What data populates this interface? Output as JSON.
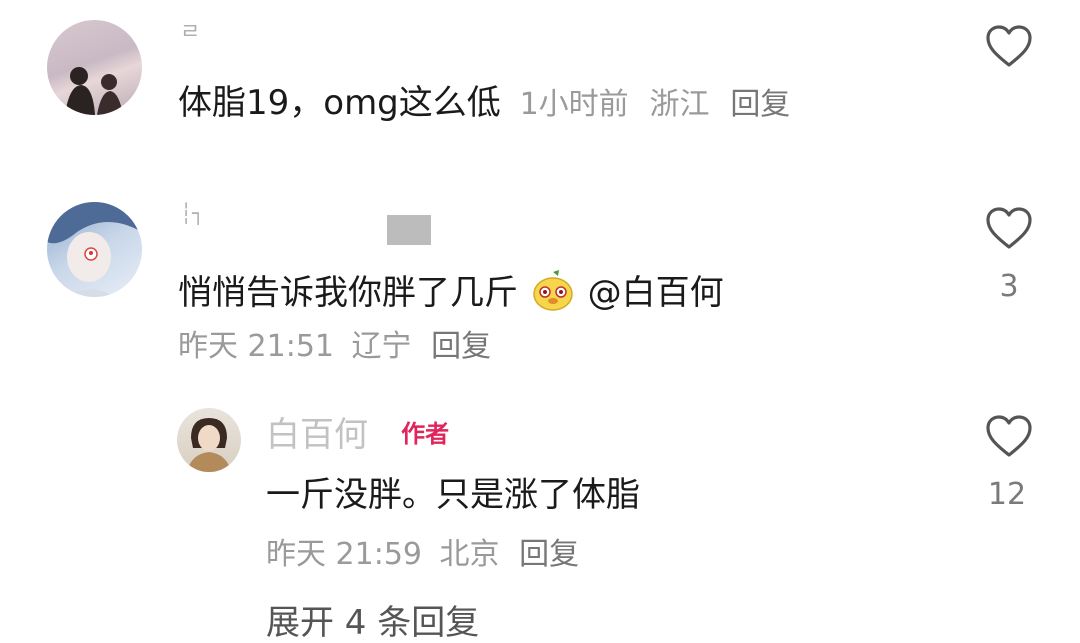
{
  "comments": [
    {
      "username": "ㄹ",
      "text": "体脂19，omg这么低",
      "time": "1小时前",
      "location": "浙江",
      "reply_label": "回复",
      "like_count": ""
    },
    {
      "username": "┆┐",
      "text": "悄悄告诉我你胖了几斤",
      "mention": "@白百何",
      "time": "昨天 21:51",
      "location": "辽宁",
      "reply_label": "回复",
      "like_count": "3"
    }
  ],
  "reply": {
    "username": "白百何",
    "badge": "作者",
    "text": "一斤没胖。只是涨了体脂",
    "time": "昨天 21:59",
    "location": "北京",
    "reply_label": "回复",
    "like_count": "12"
  },
  "expand_label": "展开 4 条回复",
  "colors": {
    "heart_stroke": "#555555",
    "author_badge": "#e0245e",
    "meta": "#9a9a9a"
  }
}
